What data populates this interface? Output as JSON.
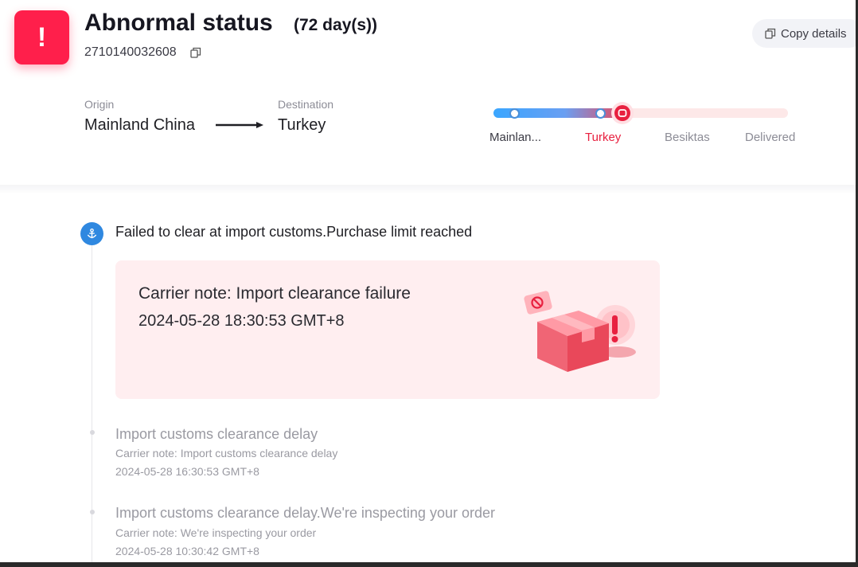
{
  "header": {
    "status_title": "Abnormal status",
    "days": "(72 day(s))",
    "tracking_number": "2710140032608",
    "copy_details_label": "Copy details",
    "status_color": "#ff1f4b"
  },
  "route": {
    "origin_label": "Origin",
    "origin_value": "Mainland China",
    "destination_label": "Destination",
    "destination_value": "Turkey"
  },
  "progress": {
    "steps": [
      "Mainlan...",
      "Turkey",
      "Besiktas",
      "Delivered"
    ],
    "current_step_index": 1,
    "fill_fraction": 0.44,
    "active_color": "#e8203f"
  },
  "timeline": {
    "current": {
      "title": "Failed to clear at import customs.Purchase limit reached",
      "icon": "anchor-icon",
      "card_note": "Carrier note: Import clearance failure",
      "card_time": "2024-05-28 18:30:53 GMT+8"
    },
    "events": [
      {
        "title": "Import customs clearance delay",
        "note": "Carrier note: Import customs clearance delay",
        "time": "2024-05-28 16:30:53 GMT+8"
      },
      {
        "title": "Import customs clearance delay.We're inspecting your order",
        "note": "Carrier note: We're inspecting your order",
        "time": "2024-05-28 10:30:42 GMT+8"
      }
    ]
  }
}
